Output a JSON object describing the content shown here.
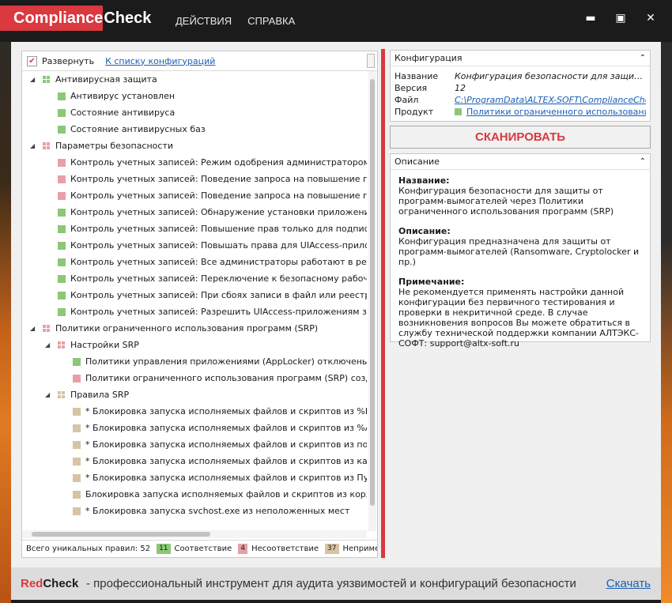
{
  "app": {
    "logo_part1": "Compliance",
    "logo_part2": "Check"
  },
  "menu": {
    "actions": "ДЕЙСТВИЯ",
    "help": "СПРАВКА"
  },
  "window_controls": {
    "minimize": "▬",
    "maximize": "▣",
    "close": "✕"
  },
  "toolbar": {
    "expand_label": "Развернуть",
    "expand_checked": true,
    "configs_link": "К списку конфигураций"
  },
  "colors": {
    "accent": "#d9393f",
    "compliance": "#8bc876",
    "noncompliance": "#e8a0a5",
    "not_applicable": "#d6c4a4"
  },
  "tree": [
    {
      "level": 0,
      "toggle": "◢",
      "icon": "grid-green",
      "text": "Антивирусная защита"
    },
    {
      "level": 1,
      "icon": "green",
      "text": "Антивирус установлен"
    },
    {
      "level": 1,
      "icon": "green",
      "text": "Состояние антивируса"
    },
    {
      "level": 1,
      "icon": "green",
      "text": "Состояние антивирусных баз"
    },
    {
      "level": 0,
      "toggle": "◢",
      "icon": "grid-red",
      "text": "Параметры безопасности"
    },
    {
      "level": 1,
      "icon": "red",
      "text": "Контроль учетных записей: Режим одобрения администратором для в"
    },
    {
      "level": 1,
      "icon": "red",
      "text": "Контроль учетных записей: Поведение запроса на повышение прав д"
    },
    {
      "level": 1,
      "icon": "red",
      "text": "Контроль учетных записей: Поведение запроса на повышение прав д"
    },
    {
      "level": 1,
      "icon": "green",
      "text": "Контроль учетных записей: Обнаружение установки приложений и за"
    },
    {
      "level": 1,
      "icon": "green",
      "text": "Контроль учетных записей: Повышение прав только для подписанных"
    },
    {
      "level": 1,
      "icon": "green",
      "text": "Контроль учетных записей: Повышать права для UIAccess-приложени"
    },
    {
      "level": 1,
      "icon": "green",
      "text": "Контроль учетных записей: Все администраторы работают в режиме"
    },
    {
      "level": 1,
      "icon": "green",
      "text": "Контроль учетных записей: Переключение к безопасному рабочему с"
    },
    {
      "level": 1,
      "icon": "green",
      "text": "Контроль учетных записей: При сбоях записи в файл или реестр вирт"
    },
    {
      "level": 1,
      "icon": "green",
      "text": "Контроль учетных записей: Разрешить UIAccess-приложениям запраш"
    },
    {
      "level": 0,
      "toggle": "◢",
      "icon": "grid-red",
      "text": "Политики ограниченного использования программ (SRP)"
    },
    {
      "level": 1,
      "toggle": "◢",
      "icon": "grid-red",
      "text": "Настройки SRP"
    },
    {
      "level": 2,
      "icon": "green",
      "text": "Политики управления приложениями (AppLocker) отключены или"
    },
    {
      "level": 2,
      "icon": "red",
      "text": "Политики ограниченного использования программ (SRP) создань"
    },
    {
      "level": 1,
      "toggle": "◢",
      "icon": "grid-tan",
      "text": "Правила SRP"
    },
    {
      "level": 2,
      "icon": "tan",
      "text": "* Блокировка запуска исполняемых файлов и скриптов из %Progra"
    },
    {
      "level": 2,
      "icon": "tan",
      "text": "* Блокировка запуска исполняемых файлов и скриптов из %AppDa"
    },
    {
      "level": 2,
      "icon": "tan",
      "text": "* Блокировка запуска исполняемых файлов и скриптов из подката"
    },
    {
      "level": 2,
      "icon": "tan",
      "text": "* Блокировка запуска исполняемых файлов и скриптов из каталог"
    },
    {
      "level": 2,
      "icon": "tan",
      "text": "* Блокировка запуска исполняемых файлов и скриптов из Пуск\\Ав"
    },
    {
      "level": 2,
      "icon": "tan",
      "text": "Блокировка запуска исполняемых файлов и скриптов из корзины"
    },
    {
      "level": 2,
      "icon": "tan",
      "text": "* Блокировка запуска svchost.exe из неположенных мест"
    }
  ],
  "status": {
    "total_label": "Всего уникальных правил: 52",
    "compliance_count": "11",
    "compliance_label": "Соответствие",
    "noncompliance_count": "4",
    "noncompliance_label": "Несоответствие",
    "na_count": "37",
    "na_label": "Неприменимо"
  },
  "config": {
    "header": "Конфигурация",
    "collapse_icon": "⌃",
    "rows": {
      "name_key": "Название",
      "name_value": "Конфигурация безопасности для защиты от программ-вымогателей через Политики ограниченного использования программ (SRP)",
      "version_key": "Версия",
      "version_value": "12",
      "file_key": "Файл",
      "file_value": "C:\\ProgramData\\ALTEX-SOFT\\ComplianceCheck\\Configurations",
      "product_key": "Продукт",
      "product_value": "Политики ограниченного использования программ"
    }
  },
  "scan_button": "СКАНИРОВАТЬ",
  "description": {
    "header": "Описание",
    "name_h": "Название:",
    "name_t": "Конфигурация безопасности для защиты от программ-вымогателей через Политики ограниченного использования программ (SRP)",
    "desc_h": "Описание:",
    "desc_t": "Конфигурация предназначена для защиты от программ-вымогателей (Ransomware, Cryptolocker и пр.)",
    "note_h": "Примечание:",
    "note_t": "Не рекомендуется применять настройки данной конфигурации без первичного тестирования и проверки в некритичной среде. В случае возникновения вопросов Вы можете обратиться в службу технической поддержки компании АЛТЭКС-СОФТ: support@altx-soft.ru"
  },
  "banner": {
    "brand_red": "Red",
    "brand_dark": "Check",
    "tagline": "- профессиональный инструмент для аудита уязвимостей и конфигураций безопасности",
    "download": "Скачать"
  }
}
